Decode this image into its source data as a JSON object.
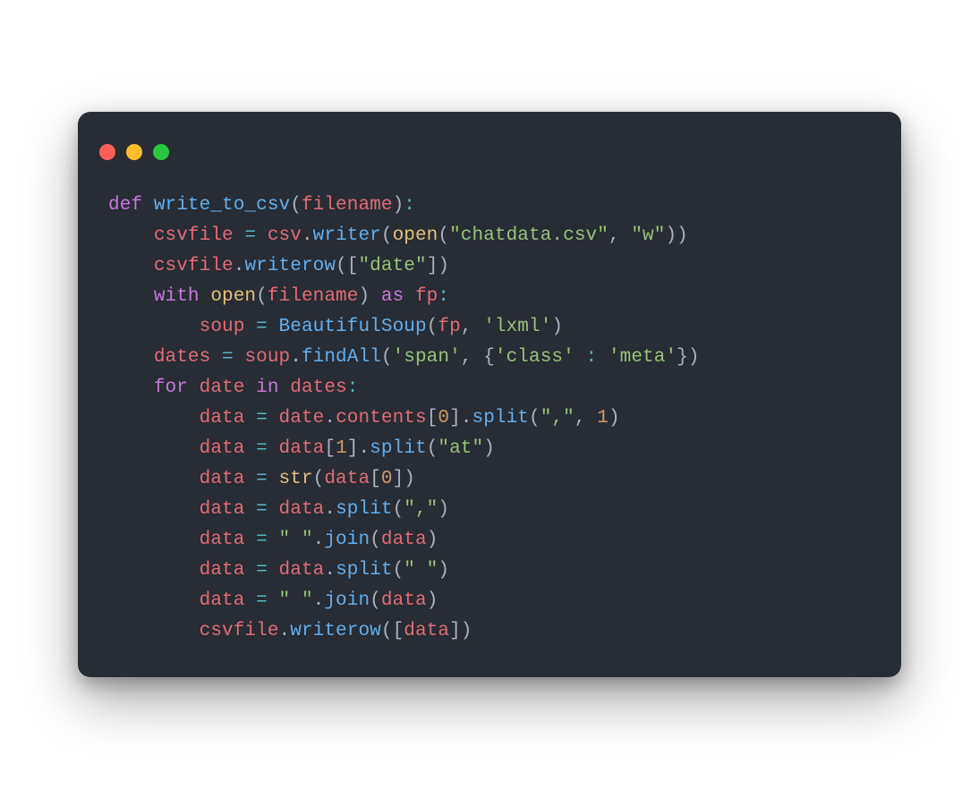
{
  "window": {
    "lights": [
      "red",
      "yellow",
      "green"
    ]
  },
  "palette": {
    "background": "#282c34",
    "keyword": "#c678dd",
    "function": "#61afef",
    "variable": "#e06c75",
    "operator": "#56b6c2",
    "string": "#98c379",
    "number": "#d19a66",
    "neutral": "#abb2bf",
    "builtin": "#e5c07b"
  },
  "code": {
    "language": "python",
    "indent": "    ",
    "tokens": [
      [
        [
          "kw",
          "def"
        ],
        [
          "pn",
          " "
        ],
        [
          "fn",
          "write_to_csv"
        ],
        [
          "pn",
          "("
        ],
        [
          "var",
          "filename"
        ],
        [
          "pn",
          ")"
        ],
        [
          "op",
          ":"
        ]
      ],
      [
        [
          "pn",
          "    "
        ],
        [
          "var",
          "csvfile"
        ],
        [
          "pn",
          " "
        ],
        [
          "op",
          "="
        ],
        [
          "pn",
          " "
        ],
        [
          "var",
          "csv"
        ],
        [
          "pn",
          "."
        ],
        [
          "fn",
          "writer"
        ],
        [
          "pn",
          "("
        ],
        [
          "bi",
          "open"
        ],
        [
          "pn",
          "("
        ],
        [
          "str",
          "\"chatdata.csv\""
        ],
        [
          "pn",
          ", "
        ],
        [
          "str",
          "\"w\""
        ],
        [
          "pn",
          "))"
        ]
      ],
      [
        [
          "pn",
          "    "
        ],
        [
          "var",
          "csvfile"
        ],
        [
          "pn",
          "."
        ],
        [
          "fn",
          "writerow"
        ],
        [
          "pn",
          "(["
        ],
        [
          "str",
          "\"date\""
        ],
        [
          "pn",
          "])"
        ]
      ],
      [
        [
          "pn",
          "    "
        ],
        [
          "kw",
          "with"
        ],
        [
          "pn",
          " "
        ],
        [
          "bi",
          "open"
        ],
        [
          "pn",
          "("
        ],
        [
          "var",
          "filename"
        ],
        [
          "pn",
          ") "
        ],
        [
          "kw",
          "as"
        ],
        [
          "pn",
          " "
        ],
        [
          "var",
          "fp"
        ],
        [
          "op",
          ":"
        ]
      ],
      [
        [
          "pn",
          "        "
        ],
        [
          "var",
          "soup"
        ],
        [
          "pn",
          " "
        ],
        [
          "op",
          "="
        ],
        [
          "pn",
          " "
        ],
        [
          "fn",
          "BeautifulSoup"
        ],
        [
          "pn",
          "("
        ],
        [
          "var",
          "fp"
        ],
        [
          "pn",
          ", "
        ],
        [
          "str",
          "'lxml'"
        ],
        [
          "pn",
          ")"
        ]
      ],
      [
        [
          "pn",
          "    "
        ],
        [
          "var",
          "dates"
        ],
        [
          "pn",
          " "
        ],
        [
          "op",
          "="
        ],
        [
          "pn",
          " "
        ],
        [
          "var",
          "soup"
        ],
        [
          "pn",
          "."
        ],
        [
          "fn",
          "findAll"
        ],
        [
          "pn",
          "("
        ],
        [
          "str",
          "'span'"
        ],
        [
          "pn",
          ", {"
        ],
        [
          "str",
          "'class'"
        ],
        [
          "pn",
          " "
        ],
        [
          "op",
          ":"
        ],
        [
          "pn",
          " "
        ],
        [
          "str",
          "'meta'"
        ],
        [
          "pn",
          "})"
        ]
      ],
      [
        [
          "pn",
          "    "
        ],
        [
          "kw",
          "for"
        ],
        [
          "pn",
          " "
        ],
        [
          "var",
          "date"
        ],
        [
          "pn",
          " "
        ],
        [
          "kw",
          "in"
        ],
        [
          "pn",
          " "
        ],
        [
          "var",
          "dates"
        ],
        [
          "op",
          ":"
        ]
      ],
      [
        [
          "pn",
          "        "
        ],
        [
          "var",
          "data"
        ],
        [
          "pn",
          " "
        ],
        [
          "op",
          "="
        ],
        [
          "pn",
          " "
        ],
        [
          "var",
          "date"
        ],
        [
          "pn",
          "."
        ],
        [
          "var",
          "contents"
        ],
        [
          "pn",
          "["
        ],
        [
          "num",
          "0"
        ],
        [
          "pn",
          "]."
        ],
        [
          "fn",
          "split"
        ],
        [
          "pn",
          "("
        ],
        [
          "str",
          "\",\""
        ],
        [
          "pn",
          ", "
        ],
        [
          "num",
          "1"
        ],
        [
          "pn",
          ")"
        ]
      ],
      [
        [
          "pn",
          "        "
        ],
        [
          "var",
          "data"
        ],
        [
          "pn",
          " "
        ],
        [
          "op",
          "="
        ],
        [
          "pn",
          " "
        ],
        [
          "var",
          "data"
        ],
        [
          "pn",
          "["
        ],
        [
          "num",
          "1"
        ],
        [
          "pn",
          "]."
        ],
        [
          "fn",
          "split"
        ],
        [
          "pn",
          "("
        ],
        [
          "str",
          "\"at\""
        ],
        [
          "pn",
          ")"
        ]
      ],
      [
        [
          "pn",
          "        "
        ],
        [
          "var",
          "data"
        ],
        [
          "pn",
          " "
        ],
        [
          "op",
          "="
        ],
        [
          "pn",
          " "
        ],
        [
          "bi",
          "str"
        ],
        [
          "pn",
          "("
        ],
        [
          "var",
          "data"
        ],
        [
          "pn",
          "["
        ],
        [
          "num",
          "0"
        ],
        [
          "pn",
          "])"
        ]
      ],
      [
        [
          "pn",
          "        "
        ],
        [
          "var",
          "data"
        ],
        [
          "pn",
          " "
        ],
        [
          "op",
          "="
        ],
        [
          "pn",
          " "
        ],
        [
          "var",
          "data"
        ],
        [
          "pn",
          "."
        ],
        [
          "fn",
          "split"
        ],
        [
          "pn",
          "("
        ],
        [
          "str",
          "\",\""
        ],
        [
          "pn",
          ")"
        ]
      ],
      [
        [
          "pn",
          "        "
        ],
        [
          "var",
          "data"
        ],
        [
          "pn",
          " "
        ],
        [
          "op",
          "="
        ],
        [
          "pn",
          " "
        ],
        [
          "str",
          "\" \""
        ],
        [
          "pn",
          "."
        ],
        [
          "fn",
          "join"
        ],
        [
          "pn",
          "("
        ],
        [
          "var",
          "data"
        ],
        [
          "pn",
          ")"
        ]
      ],
      [
        [
          "pn",
          "        "
        ],
        [
          "var",
          "data"
        ],
        [
          "pn",
          " "
        ],
        [
          "op",
          "="
        ],
        [
          "pn",
          " "
        ],
        [
          "var",
          "data"
        ],
        [
          "pn",
          "."
        ],
        [
          "fn",
          "split"
        ],
        [
          "pn",
          "("
        ],
        [
          "str",
          "\" \""
        ],
        [
          "pn",
          ")"
        ]
      ],
      [
        [
          "pn",
          "        "
        ],
        [
          "var",
          "data"
        ],
        [
          "pn",
          " "
        ],
        [
          "op",
          "="
        ],
        [
          "pn",
          " "
        ],
        [
          "str",
          "\" \""
        ],
        [
          "pn",
          "."
        ],
        [
          "fn",
          "join"
        ],
        [
          "pn",
          "("
        ],
        [
          "var",
          "data"
        ],
        [
          "pn",
          ")"
        ]
      ],
      [
        [
          "pn",
          "        "
        ],
        [
          "var",
          "csvfile"
        ],
        [
          "pn",
          "."
        ],
        [
          "fn",
          "writerow"
        ],
        [
          "pn",
          "(["
        ],
        [
          "var",
          "data"
        ],
        [
          "pn",
          "])"
        ]
      ]
    ]
  }
}
